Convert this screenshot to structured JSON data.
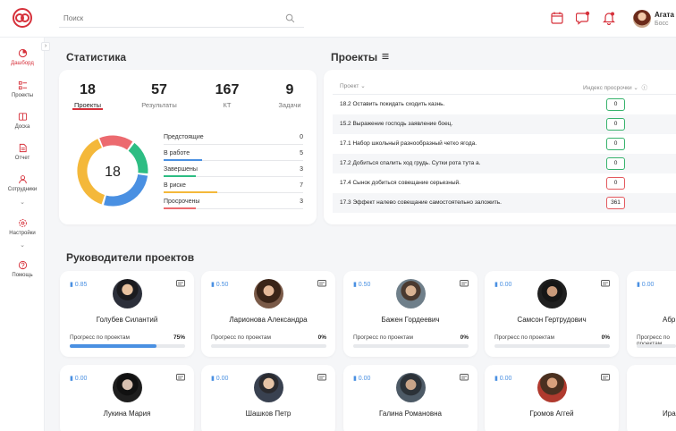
{
  "header": {
    "search_placeholder": "Поиск",
    "user_name": "Агата О",
    "user_role": "Босс"
  },
  "sidebar": {
    "items": [
      {
        "label": "Дашборд",
        "icon": "dashboard-icon",
        "active": true
      },
      {
        "label": "Проекты",
        "icon": "projects-icon"
      },
      {
        "label": "Доска",
        "icon": "board-icon"
      },
      {
        "label": "Отчет",
        "icon": "report-icon"
      },
      {
        "label": "Сотрудники",
        "icon": "employees-icon"
      },
      {
        "label": "Настройки",
        "icon": "settings-icon"
      },
      {
        "label": "Помощь",
        "icon": "help-icon"
      }
    ]
  },
  "statistics": {
    "title": "Статистика",
    "stats": [
      {
        "value": "18",
        "label": "Проекты"
      },
      {
        "value": "57",
        "label": "Результаты"
      },
      {
        "value": "167",
        "label": "КТ"
      },
      {
        "value": "9",
        "label": "Задачи"
      }
    ],
    "donut_total": "18",
    "legend": [
      {
        "label": "Предстоящие",
        "value": "0",
        "color": "#cfd2d6"
      },
      {
        "label": "В работе",
        "value": "5",
        "color": "#4a90e2"
      },
      {
        "label": "Завершены",
        "value": "3",
        "color": "#2dbd83"
      },
      {
        "label": "В риске",
        "value": "7",
        "color": "#f4b83a"
      },
      {
        "label": "Просрочены",
        "value": "3",
        "color": "#ec6a6f"
      }
    ]
  },
  "projects": {
    "title": "Проекты",
    "col_project": "Проект",
    "col_index": "Индекс просрочки",
    "rows": [
      {
        "name": "18.2 Оставить покидать сходить казнь.",
        "index": "0"
      },
      {
        "name": "15.2 Выражение господь заявление боец.",
        "index": "0"
      },
      {
        "name": "17.1 Набор школьный разнообразный четко ягода.",
        "index": "0"
      },
      {
        "name": "17.2 Добиться спалить ход грудь. Сутки рота тута а.",
        "index": "0"
      },
      {
        "name": "17.4 Сынок добиться совещание серьезный.",
        "index": "0"
      },
      {
        "name": "17.3 Эффект налево совещание самостоятельно заложить.",
        "index": "361"
      }
    ]
  },
  "managers": {
    "title": "Руководители проектов",
    "progress_label": "Прогресс по проектам",
    "items": [
      {
        "name": "Голубев Силантий",
        "score": "0.85",
        "percent": "75%",
        "fill": 0.75
      },
      {
        "name": "Ларионова Александра",
        "score": "0.50",
        "percent": "0%",
        "fill": 0
      },
      {
        "name": "Бажен Гордеевич",
        "score": "0.50",
        "percent": "0%",
        "fill": 0
      },
      {
        "name": "Самсон Гертрудович",
        "score": "0.00",
        "percent": "0%",
        "fill": 0
      },
      {
        "name": "Абр",
        "score": "0.00",
        "percent": "0%",
        "fill": 0
      },
      {
        "name": "Лукина Мария",
        "score": "0.00",
        "percent": "",
        "fill": 0
      },
      {
        "name": "Шашков Петр",
        "score": "0.00",
        "percent": "",
        "fill": 0
      },
      {
        "name": "Галина Романовна",
        "score": "0.00",
        "percent": "",
        "fill": 0
      },
      {
        "name": "Громов Аггей",
        "score": "0.00",
        "percent": "",
        "fill": 0
      },
      {
        "name": "Ира",
        "score": "",
        "percent": "",
        "fill": 0
      }
    ]
  }
}
